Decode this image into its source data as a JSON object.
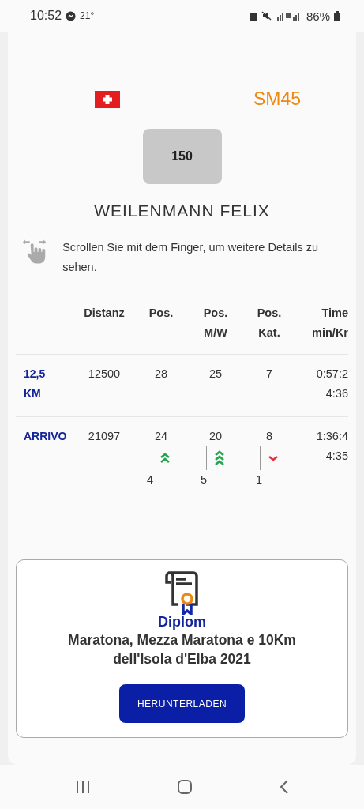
{
  "status_bar": {
    "time": "10:52",
    "temperature": "21°",
    "battery": "86%"
  },
  "athlete": {
    "category": "SM45",
    "bib": "150",
    "name": "WEILENMANN FELIX"
  },
  "scroll_hint": "Scrollen Sie mit dem Finger, um weitere Details zu sehen.",
  "table": {
    "columns": [
      "Distanz",
      "Pos.",
      "Pos. M/W",
      "Pos. Kat.",
      "Time min/Kr"
    ],
    "rows": [
      {
        "label": "12,5 KM",
        "distance": "12500",
        "positions": [
          {
            "value": "28"
          },
          {
            "value": "25"
          },
          {
            "value": "7"
          }
        ],
        "time": "0:57:2",
        "pace": "4:36"
      },
      {
        "label": "ARRIVO",
        "distance": "21097",
        "positions": [
          {
            "value": "24",
            "kind": "up-double",
            "change": "4"
          },
          {
            "value": "20",
            "kind": "up-triple",
            "change": "5"
          },
          {
            "value": "8",
            "kind": "down",
            "change": "1"
          }
        ],
        "time": "1:36:4",
        "pace": "4:35"
      }
    ]
  },
  "diploma": {
    "title": "Diplom",
    "event": "Maratona, Mezza Maratona e 10Km dell'Isola d'Elba 2021",
    "button": "HERUNTERLADEN"
  }
}
